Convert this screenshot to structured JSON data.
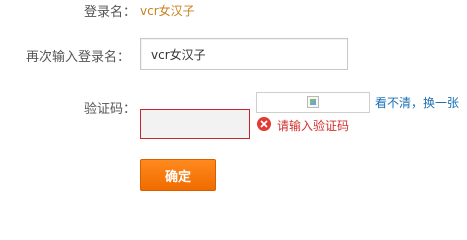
{
  "login": {
    "label": "登录名：",
    "value": "vcr女汉子"
  },
  "confirm": {
    "label": "再次输入登录名：",
    "value": "vcr女汉子"
  },
  "captcha": {
    "label": "验证码：",
    "value": "",
    "refresh_link": "看不清，换一张",
    "error_text": "请输入验证码"
  },
  "submit": {
    "label": "确定"
  },
  "colors": {
    "login_value": "#c8801e",
    "error": "#d0312d",
    "link": "#1a6fb5",
    "button": "#f47a0c"
  }
}
